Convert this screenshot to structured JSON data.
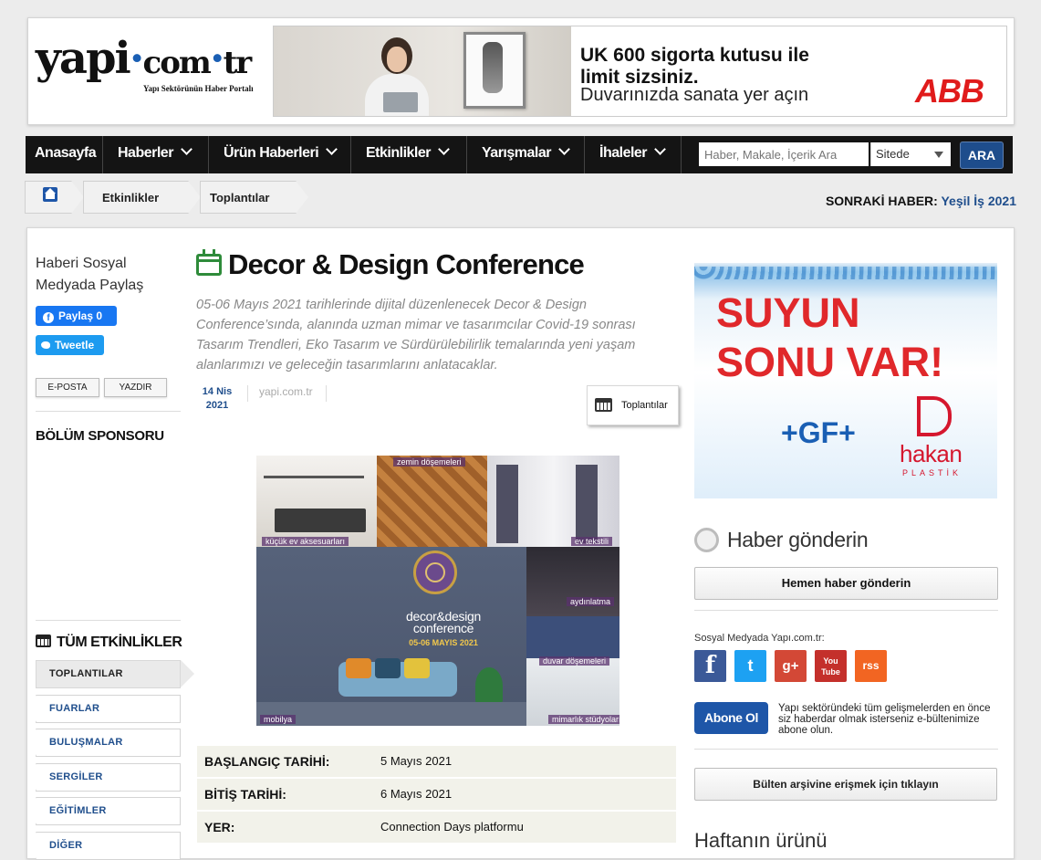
{
  "header": {
    "logo_text_a": "yapi",
    "logo_text_dot1": "·",
    "logo_text_b": "com",
    "logo_text_dot2": "·",
    "logo_text_c": "tr",
    "logo_tagline": "Yapı Sektörünün Haber Portalı",
    "banner_line1": "UK 600 sigorta kutusu ile",
    "banner_line2": "limit sizsiniz.",
    "banner_line3": "Duvarınızda sanata yer açın",
    "banner_brand": "ABB"
  },
  "nav": {
    "items": [
      {
        "label": "Anasayfa",
        "dropdown": false
      },
      {
        "label": "Haberler",
        "dropdown": true
      },
      {
        "label": "Ürün Haberleri",
        "dropdown": true
      },
      {
        "label": "Etkinlikler",
        "dropdown": true
      },
      {
        "label": "Yarışmalar",
        "dropdown": true
      },
      {
        "label": "İhaleler",
        "dropdown": true
      }
    ],
    "search_placeholder": "Haber, Makale, İçerik Ara",
    "search_scope": "Sitede",
    "search_button": "ARA"
  },
  "breadcrumb": {
    "items": [
      "Etkinlikler",
      "Toplantılar"
    ]
  },
  "next_news": {
    "label": "SONRAKİ HABER:",
    "title": "Yeşil İş 2021"
  },
  "sidebar": {
    "share_title": "Haberi Sosyal Medyada Paylaş",
    "facebook_label": "Paylaş 0",
    "twitter_label": "Tweetle",
    "email_label": "E-POSTA",
    "print_label": "YAZDIR",
    "sponsor_title": "BÖLÜM SPONSORU",
    "all_events_title": "TÜM ETKİNLİKLER",
    "categories": [
      "TOPLANTILAR",
      "FUARLAR",
      "BULUŞMALAR",
      "SERGİLER",
      "EĞİTİMLER",
      "DİĞER"
    ],
    "active_category": "TOPLANTILAR"
  },
  "article": {
    "title": "Decor & Design Conference",
    "summary": "05-06 Mayıs 2021 tarihlerinde dijital düzenlenecek Decor & Design Conference’sında, alanında uzman mimar ve tasarımcılar Covid-19 sonrası Tasarım Trendleri, Eko Tasarım ve Sürdürülebilirlik temalarında yeni yaşam alanlarımızı ve geleceğin tasarımlarını anlatacaklar.",
    "date_day": "14 Nis",
    "date_year": "2021",
    "source": "yapi.com.tr",
    "category_tag": "Toplantılar",
    "poster": {
      "label_floor": "zemin döşemeleri",
      "label_accessories": "küçük ev aksesuarları",
      "label_textile": "ev tekstili",
      "label_lighting": "aydınlatma",
      "label_wall": "duvar döşemeleri",
      "label_furniture": "mobilya",
      "label_studios": "mimarlık stüdyoları",
      "brand_line1": "decor&design",
      "brand_line2": "conference",
      "dates": "05-06 MAYIS 2021"
    },
    "info": [
      {
        "key": "BAŞLANGIÇ TARİHİ:",
        "value": "5 Mayıs 2021"
      },
      {
        "key": "BİTİŞ TARİHİ:",
        "value": "6 Mayıs 2021"
      },
      {
        "key": "YER:",
        "value": "Connection Days platformu"
      }
    ]
  },
  "right": {
    "ad_line1": "SUYUN",
    "ad_line2": "SONU VAR!",
    "ad_brand1": "+GF+",
    "ad_brand2": "hakan",
    "ad_brand2_sub": "PLASTİK",
    "send_title": "Haber gönderin",
    "send_button": "Hemen haber gönderin",
    "social_title": "Sosyal Medyada Yapı.com.tr:",
    "social_icons": [
      "f",
      "t",
      "g+",
      "You Tube",
      "rss"
    ],
    "subscribe_button": "Abone Ol",
    "subscribe_text": "Yapı sektöründeki tüm gelişmelerden en önce siz haberdar olmak isterseniz e-bültenimize abone olun.",
    "archive_button": "Bülten arşivine erişmek için tıklayın",
    "week_title": "Haftanın ürünü"
  },
  "colors": {
    "nav_bg": "#141414",
    "link_blue": "#1f4e8c",
    "accent_green": "#2e8b3a",
    "ad_red": "#e0282b"
  }
}
